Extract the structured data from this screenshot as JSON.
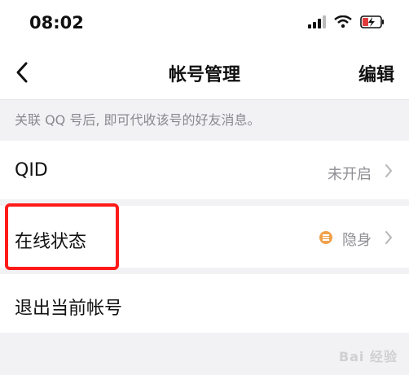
{
  "status_bar": {
    "time": "08:02"
  },
  "nav": {
    "title": "帐号管理",
    "edit_label": "编辑"
  },
  "hint": "关联 QQ 号后, 即可代收该号的好友消息。",
  "rows": {
    "qid": {
      "label": "QID",
      "value": "未开启"
    },
    "online_status": {
      "label": "在线状态",
      "value": "隐身"
    },
    "logout": {
      "label": "退出当前帐号"
    }
  },
  "colors": {
    "highlight_border": "#ff1a1a",
    "status_dot": "#f0a14b"
  },
  "watermark": "Bai 经验"
}
